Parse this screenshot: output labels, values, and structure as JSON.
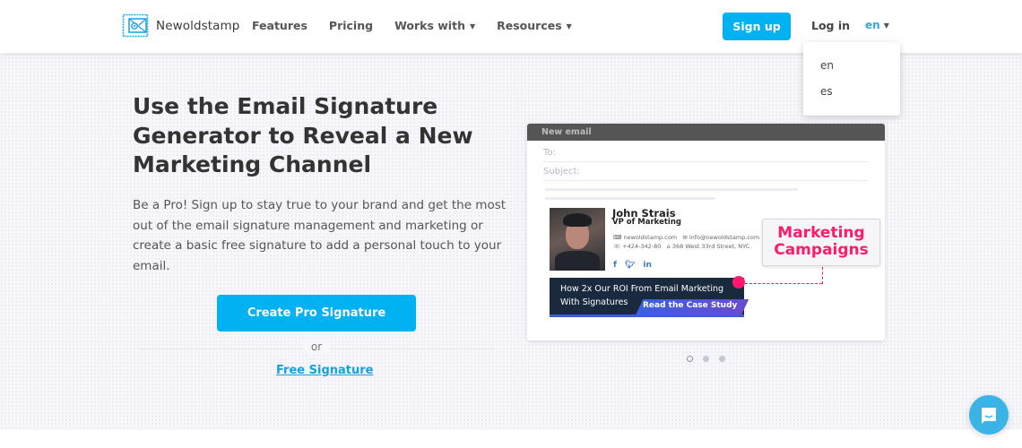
{
  "header": {
    "logo_text": "Newoldstamp",
    "nav": [
      {
        "label": "Features",
        "has_dropdown": false
      },
      {
        "label": "Pricing",
        "has_dropdown": false
      },
      {
        "label": "Works with",
        "has_dropdown": true
      },
      {
        "label": "Resources",
        "has_dropdown": true
      }
    ],
    "signup_label": "Sign up",
    "login_label": "Log in",
    "language": {
      "selected": "en",
      "options": [
        "en",
        "es"
      ]
    }
  },
  "hero": {
    "title": "Use the Email Signature Generator to Reveal a New Marketing Channel",
    "description": "Be a Pro! Sign up to stay true to your brand and get the most out of the email signature management and marketing or create a basic free signature to add a personal touch to your email.",
    "cta_label": "Create Pro Signature",
    "or_text": "or",
    "free_link": "Free Signature"
  },
  "mockup": {
    "window_title": "New email",
    "to_label": "To:",
    "subject_label": "Subject:",
    "signature": {
      "name": "John Strais",
      "role": "VP of Marketing",
      "website": "newoldstamp.com",
      "email": "info@newoldstamp.com",
      "phone": "+424-342-80",
      "address": "368 West 33rd Street, NYC",
      "social": [
        "f",
        "t",
        "in"
      ]
    },
    "banner_text_line1": "How 2x Our ROI From Email Marketing",
    "banner_text_line2": "With Signatures",
    "banner_button": "Read the Case Study",
    "callout_line1": "Marketing",
    "callout_line2": "Campaigns"
  },
  "carousel": {
    "count": 3,
    "active_index": 0
  },
  "colors": {
    "accent": "#00b2f2",
    "callout": "#ff1a6c",
    "link": "#1a9fd8"
  }
}
